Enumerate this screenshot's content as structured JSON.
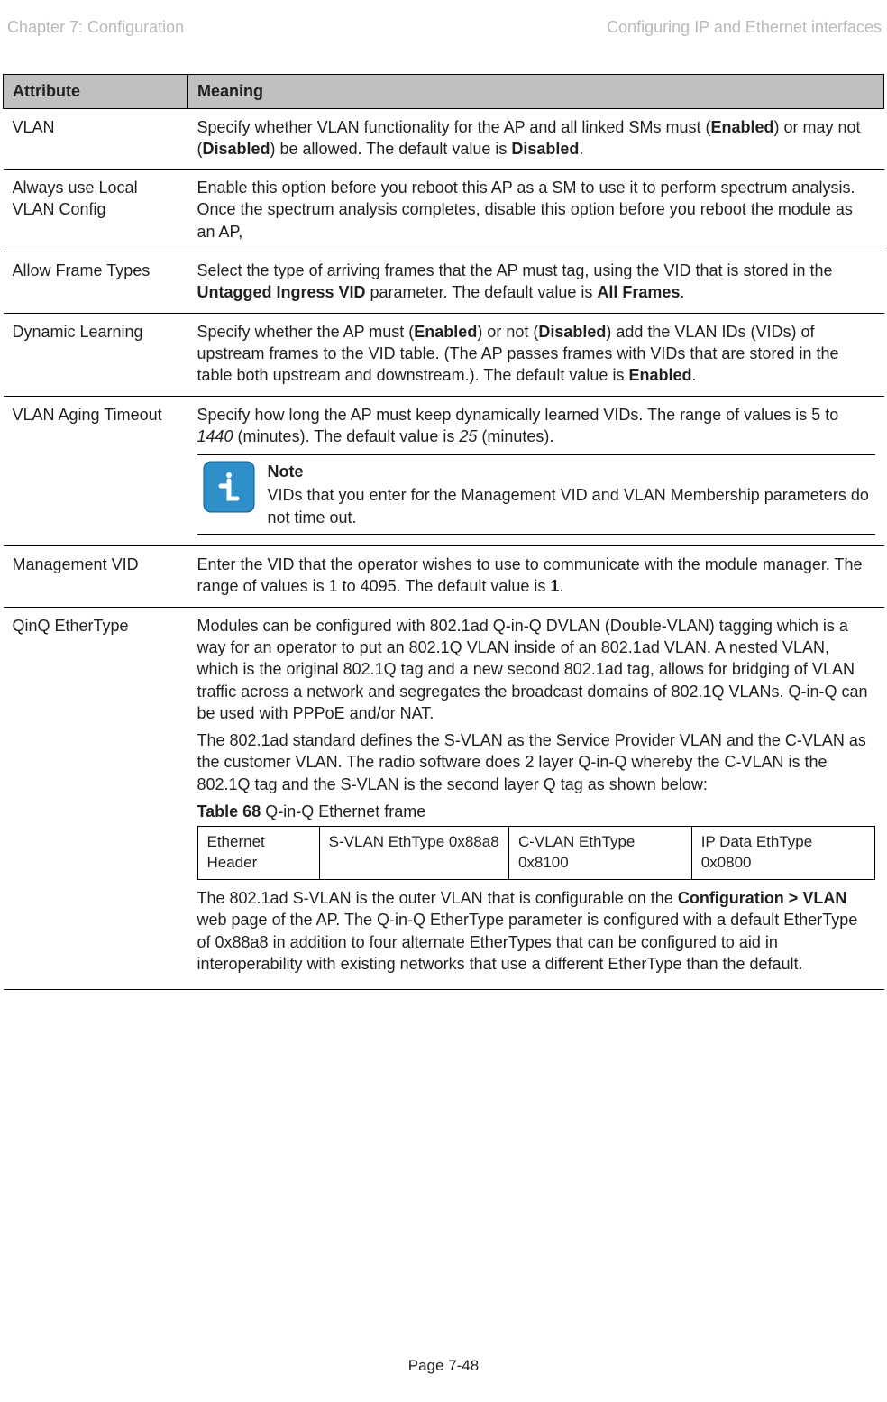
{
  "header": {
    "left": "Chapter 7:  Configuration",
    "right": "Configuring IP and Ethernet interfaces"
  },
  "table": {
    "head_attribute": "Attribute",
    "head_meaning": "Meaning",
    "rows": {
      "vlan": {
        "attr": "VLAN",
        "pre": "Specify whether VLAN functionality for the AP and all linked SMs must (",
        "b1": "Enabled",
        "mid": ") or may not (",
        "b2": "Disabled",
        "post1": ") be allowed. The default value is ",
        "b3": "Disabled",
        "post2": "."
      },
      "always": {
        "attr": "Always use Local VLAN Config",
        "text": "Enable this option before you reboot this AP as a SM to use it to perform spectrum analysis. Once the spectrum analysis completes, disable this option before you reboot the module as an AP,"
      },
      "allow": {
        "attr": "Allow Frame Types",
        "pre": "Select the type of arriving frames that the AP must tag, using the VID that is stored in the ",
        "b1": "Untagged Ingress VID",
        "mid": " parameter. The default value is ",
        "b2": "All Frames",
        "post": "."
      },
      "dynamic": {
        "attr": "Dynamic Learning",
        "pre": "Specify whether the AP must (",
        "b1": "Enabled",
        "mid1": ") or not (",
        "b2": "Disabled",
        "mid2": ") add the VLAN IDs (VIDs) of upstream frames to the VID table. (The AP passes frames with VIDs that are stored in the table both upstream and downstream.). The default value is ",
        "b3": "Enabled",
        "post": "."
      },
      "aging": {
        "attr": "VLAN Aging Timeout",
        "p1_pre": "Specify how long the AP must keep dynamically learned VIDs. The range of values is 5 to ",
        "p1_i1": "1440",
        "p1_mid": " (minutes). The default value is ",
        "p1_i2": "25",
        "p1_post": " (minutes).",
        "note_label": "Note",
        "note_text": "VIDs that you enter for the Management VID and VLAN Membership parameters do not time out."
      },
      "mgmt": {
        "attr": "Management VID",
        "pre": "Enter the VID that the operator wishes to use to communicate with the module manager. The range of values is 1 to 4095. The default value is ",
        "b1": "1",
        "post": "."
      },
      "qinq": {
        "attr": "QinQ EtherType",
        "p1": "Modules can be configured with 802.1ad Q-in-Q DVLAN (Double-VLAN) tagging which is a way for an operator to put an 802.1Q VLAN inside of an 802.1ad VLAN.  A nested VLAN, which is the original 802.1Q tag and a new second 802.1ad tag, allows for bridging of VLAN traffic across a network and segregates the broadcast domains of 802.1Q VLANs.  Q-in-Q can be used with PPPoE and/or NAT.",
        "p2": "The 802.1ad standard defines the S-VLAN as the Service Provider VLAN and the C-VLAN as the customer VLAN.  The radio software does 2 layer Q-in-Q whereby the C-VLAN is the 802.1Q tag and the S-VLAN is the second layer Q tag as shown below:",
        "caption_b": "Table 68",
        "caption_rest": " Q-in-Q Ethernet frame",
        "sub_c1": "Ethernet Header",
        "sub_c2": "S-VLAN EthType 0x88a8",
        "sub_c3": "C-VLAN EthType 0x8100",
        "sub_c4": "IP Data EthType 0x0800",
        "p3_pre": "The 802.1ad S-VLAN is the outer VLAN that is configurable on the ",
        "p3_b1": "Configuration > VLAN",
        "p3_post": " web page of the AP.  The Q-in-Q EtherType parameter is configured with a default EtherType of 0x88a8 in addition to four alternate EtherTypes that can be configured to aid in interoperability with existing networks that use a different EtherType than the default."
      }
    }
  },
  "footer": "Page 7-48"
}
